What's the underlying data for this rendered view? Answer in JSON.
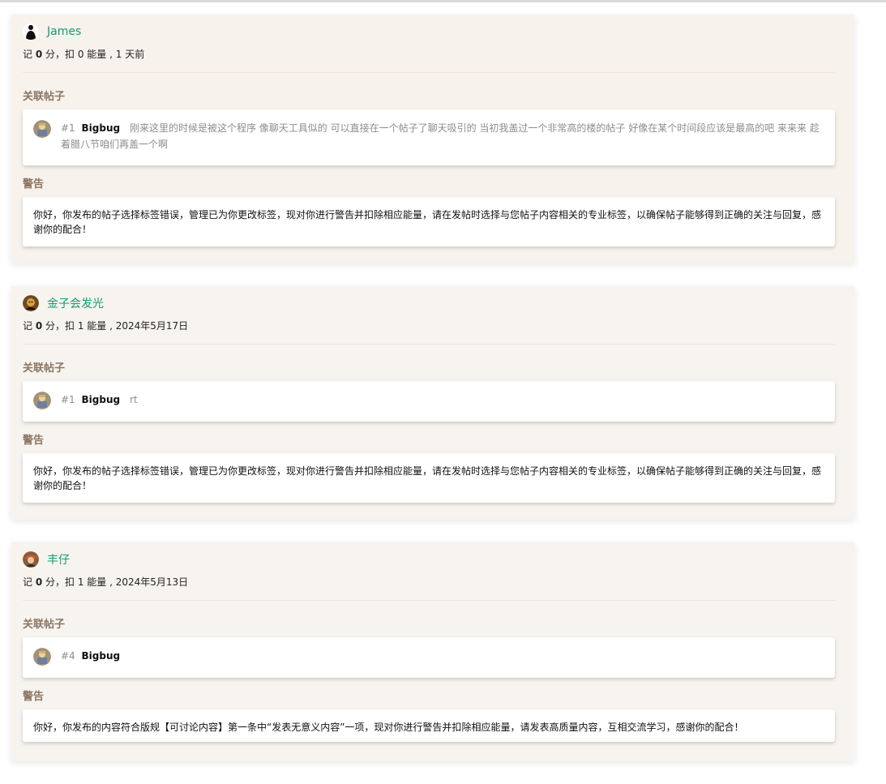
{
  "feed": [
    {
      "user": {
        "name": "James",
        "avatar_icon": "user-avatar-silhouette-icon"
      },
      "meta": {
        "prefix": "记",
        "score": "0",
        "mid": "分，扣 0 能量 , 1 天前"
      },
      "linked_title": "关联帖子",
      "post": {
        "num": "#1",
        "author": "Bigbug",
        "text": "刚来这里的时候是被这个程序 像聊天工具似的 可以直接在一个帖子了聊天吸引的 当初我盖过一个非常高的楼的帖子 好像在某个时间段应该是最高的吧 来来来 趁着腊八节咱们再盖一个啊",
        "avatar_icon": "bigbug-avatar-icon"
      },
      "warning_title": "警告",
      "warning_text": "你好，你发布的帖子选择标签错误，管理已为你更改标签，现对你进行警告并扣除相应能量，请在发帖时选择与您帖子内容相关的专业标签，以确保帖子能够得到正确的关注与回复，感谢你的配合！"
    },
    {
      "user": {
        "name": "金子会发光",
        "avatar_icon": "user-avatar-icon"
      },
      "meta": {
        "prefix": "记",
        "score": "0",
        "mid": "分，扣 1 能量 , 2024年5月17日"
      },
      "linked_title": "关联帖子",
      "post": {
        "num": "#1",
        "author": "Bigbug",
        "text": "rt",
        "avatar_icon": "bigbug-avatar-icon"
      },
      "warning_title": "警告",
      "warning_text": "你好，你发布的帖子选择标签错误，管理已为你更改标签，现对你进行警告并扣除相应能量，请在发帖时选择与您帖子内容相关的专业标签，以确保帖子能够得到正确的关注与回复，感谢你的配合！"
    },
    {
      "user": {
        "name": "丰仔",
        "avatar_icon": "user-avatar-icon"
      },
      "meta": {
        "prefix": "记",
        "score": "0",
        "mid": "分，扣 1 能量 , 2024年5月13日"
      },
      "linked_title": "关联帖子",
      "post": {
        "num": "#4",
        "author": "Bigbug",
        "text": "",
        "avatar_icon": "bigbug-avatar-icon"
      },
      "warning_title": "警告",
      "warning_text": "你好，你发布的内容符合版规【可讨论内容】第一条中“发表无意义内容”一项，现对你进行警告并扣除相应能量，请发表高质量内容，互相交流学习，感谢你的配合！"
    }
  ]
}
